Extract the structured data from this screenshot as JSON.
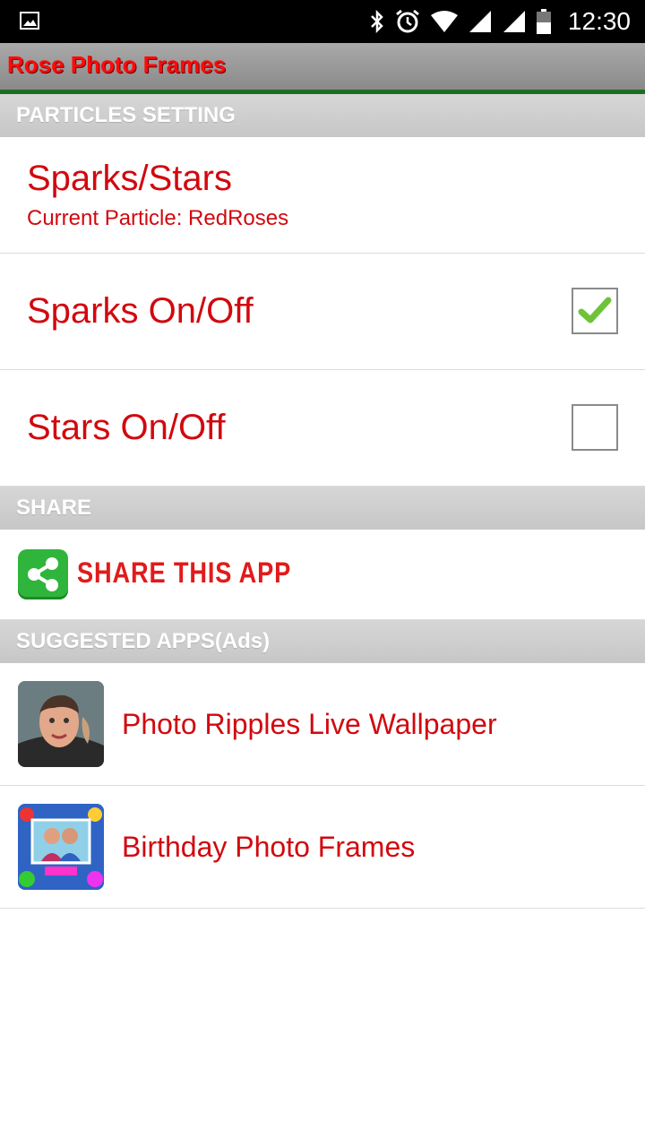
{
  "status_bar": {
    "time": "12:30",
    "icons": [
      "image-notification-icon",
      "bluetooth-icon",
      "alarm-icon",
      "wifi-icon",
      "cell-signal-icon",
      "cell-signal-icon",
      "battery-icon"
    ]
  },
  "app_bar": {
    "title": "Rose Photo Frames"
  },
  "sections": {
    "particles": {
      "header": "PARTICLES SETTING",
      "sparks_stars": {
        "title": "Sparks/Stars",
        "summary": "Current Particle:  RedRoses"
      },
      "sparks_toggle": {
        "title": "Sparks On/Off",
        "checked": true
      },
      "stars_toggle": {
        "title": "Stars On/Off",
        "checked": false
      }
    },
    "share": {
      "header": "SHARE",
      "share_label": "SHARE THIS APP"
    },
    "suggested": {
      "header": "SUGGESTED APPS(Ads)",
      "apps": [
        {
          "name": "Photo Ripples Live Wallpaper",
          "icon": "portrait-thumbnail"
        },
        {
          "name": "Birthday Photo Frames",
          "icon": "birthday-frame-thumbnail"
        }
      ]
    }
  },
  "colors": {
    "accent_red": "#d1090f",
    "title_red": "#ff0a0a",
    "appbar_border": "#1f6d22",
    "check_green": "#6fc33a",
    "share_green": "#2fb53c"
  }
}
